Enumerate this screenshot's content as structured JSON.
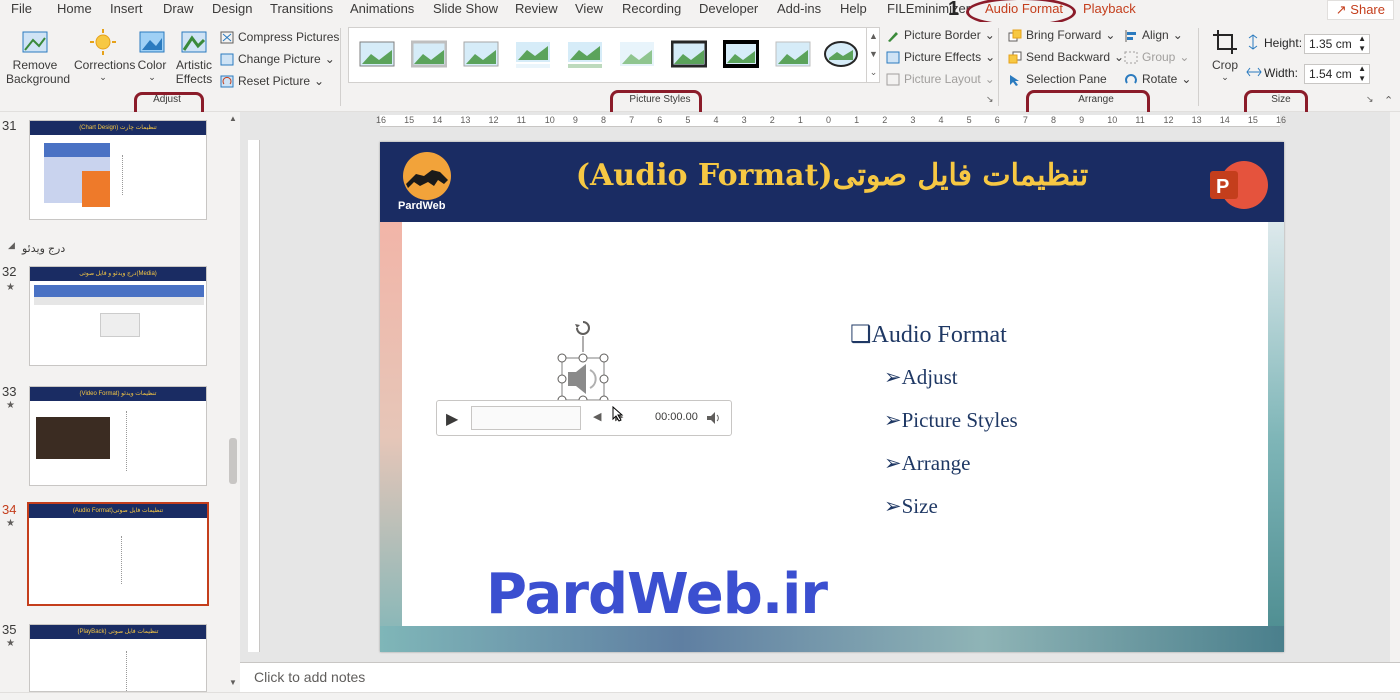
{
  "menu": {
    "tabs": [
      "File",
      "Home",
      "Insert",
      "Draw",
      "Design",
      "Transitions",
      "Animations",
      "Slide Show",
      "Review",
      "View",
      "Recording",
      "Developer",
      "Add-ins",
      "Help",
      "FILEminimizer",
      "Audio Format",
      "Playback"
    ],
    "active_tab": "Audio Format",
    "annotation_number": "1",
    "share_label": "Share"
  },
  "ribbon": {
    "adjust": {
      "remove_background": "Remove Background",
      "corrections": "Corrections",
      "color": "Color",
      "artistic_effects": "Artistic Effects",
      "compress_pictures": "Compress Pictures",
      "change_picture": "Change Picture",
      "reset_picture": "Reset Picture",
      "group_label": "Adjust"
    },
    "picture_styles": {
      "picture_border": "Picture Border",
      "picture_effects": "Picture Effects",
      "picture_layout": "Picture Layout",
      "group_label": "Picture Styles"
    },
    "arrange": {
      "bring_forward": "Bring Forward",
      "send_backward": "Send Backward",
      "selection_pane": "Selection Pane",
      "align": "Align",
      "group": "Group",
      "rotate": "Rotate",
      "group_label": "Arrange"
    },
    "size": {
      "crop": "Crop",
      "height_label": "Height:",
      "height_value": "1.35 cm",
      "width_label": "Width:",
      "width_value": "1.54 cm",
      "group_label": "Size"
    }
  },
  "thumbnails": {
    "section_title": "درج ویدئو",
    "slides": [
      {
        "num": "31",
        "title": "(Chart Design) تنظیمات چارت",
        "star": false
      },
      {
        "num": "32",
        "title": "درج ویدئو و فایل صوتی(Media)",
        "star": true
      },
      {
        "num": "33",
        "title": "(Video Format) تنظیمات ویدئو",
        "star": true
      },
      {
        "num": "34",
        "title": "(Audio Format)تنظیمات فایل صوتی",
        "star": true
      },
      {
        "num": "35",
        "title": "(PlayBack) تنظیمات فایل صوتی",
        "star": true
      }
    ]
  },
  "ruler": {
    "h_ticks": [
      "16",
      "15",
      "14",
      "13",
      "12",
      "11",
      "10",
      "9",
      "8",
      "7",
      "6",
      "5",
      "4",
      "3",
      "2",
      "1",
      "0",
      "1",
      "2",
      "3",
      "4",
      "5",
      "6",
      "7",
      "8",
      "9",
      "10",
      "11",
      "12",
      "13",
      "14",
      "15",
      "16"
    ]
  },
  "slide": {
    "title": "تنظیمات فایل صوتی(Audio Format)",
    "logo_text": "PardWeb",
    "bullet_main": "Audio Format",
    "bullets": [
      "Adjust",
      "Picture Styles",
      "Arrange",
      "Size"
    ],
    "watermark": "PardWeb.ir",
    "player_time": "00:00.00"
  },
  "notes": {
    "placeholder": "Click to add notes"
  },
  "colors": {
    "accent": "#c43e1c",
    "annotation": "#8b1c2a",
    "banner": "#1a2c63",
    "title_gold": "#f7c843",
    "watermark_blue": "#3b4fd0"
  }
}
